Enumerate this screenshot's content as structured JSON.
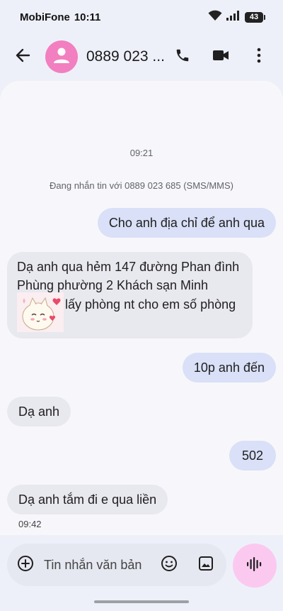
{
  "status_bar": {
    "carrier": "MobiFone",
    "time": "10:11",
    "battery": "43"
  },
  "header": {
    "contact_name": "0889 023 ...",
    "icons": [
      "back-arrow-icon",
      "person-icon",
      "phone-icon",
      "video-icon",
      "more-vert-icon"
    ]
  },
  "conversation": {
    "timestamp_top": "09:21",
    "info": "Đang nhắn tin với 0889 023 685 (SMS/MMS)",
    "messages": [
      {
        "direction": "out",
        "text": "Cho anh địa chỉ để anh qua"
      },
      {
        "direction": "in",
        "lines": [
          "Dạ anh qua hẻm 147 đường Phan đình",
          "Phùng phường 2 Khách sạn Minh",
          "lấy phòng nt cho em số phòng"
        ],
        "has_sticker": true
      },
      {
        "direction": "out",
        "text": "10p anh đến"
      },
      {
        "direction": "in",
        "text": "Dạ anh"
      },
      {
        "direction": "out",
        "text": "502"
      },
      {
        "direction": "in",
        "text": "Dạ anh tắm đi e qua liền"
      }
    ],
    "timestamp_bottom": "09:42"
  },
  "composer": {
    "placeholder": "Tin nhắn văn bản",
    "icons": [
      "add-circle-icon",
      "emoji-icon",
      "gallery-icon",
      "voice-icon"
    ]
  },
  "colors": {
    "avatar": "#f27fbf",
    "outgoing_bubble": "#d9e0f7",
    "incoming_bubble": "#e8e8ef",
    "mic_button": "#fbc9ef"
  }
}
